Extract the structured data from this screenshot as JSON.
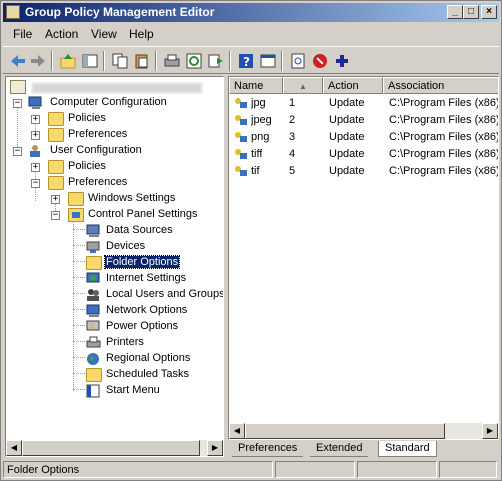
{
  "window": {
    "title": "Group Policy Management Editor"
  },
  "menu": [
    "File",
    "Action",
    "View",
    "Help"
  ],
  "toolbar_icons": [
    "back-icon",
    "forward-icon",
    "up-folder-icon",
    "show-hide-tree-icon",
    "copy-icon",
    "paste-icon",
    "print-icon",
    "refresh-icon",
    "export-icon",
    "help-icon",
    "properties-icon",
    "new-item-icon",
    "stop-icon",
    "add-icon"
  ],
  "tree": {
    "root": "",
    "computer_config": "Computer Configuration",
    "cc_policies": "Policies",
    "cc_preferences": "Preferences",
    "user_config": "User Configuration",
    "uc_policies": "Policies",
    "uc_preferences": "Preferences",
    "windows_settings": "Windows Settings",
    "control_panel": "Control Panel Settings",
    "items": [
      "Data Sources",
      "Devices",
      "Folder Options",
      "Internet Settings",
      "Local Users and Groups",
      "Network Options",
      "Power Options",
      "Printers",
      "Regional Options",
      "Scheduled Tasks",
      "Start Menu"
    ]
  },
  "list": {
    "columns": [
      "Name",
      "Action",
      "Association"
    ],
    "rows": [
      {
        "name": "jpg",
        "order": "1",
        "action": "Update",
        "assoc": "C:\\Program Files (x86)"
      },
      {
        "name": "jpeg",
        "order": "2",
        "action": "Update",
        "assoc": "C:\\Program Files (x86)"
      },
      {
        "name": "png",
        "order": "3",
        "action": "Update",
        "assoc": "C:\\Program Files (x86)"
      },
      {
        "name": "tiff",
        "order": "4",
        "action": "Update",
        "assoc": "C:\\Program Files (x86)"
      },
      {
        "name": "tif",
        "order": "5",
        "action": "Update",
        "assoc": "C:\\Program Files (x86)"
      }
    ]
  },
  "tabs": [
    "Preferences",
    "Extended",
    "Standard"
  ],
  "status": {
    "text": "Folder Options"
  }
}
